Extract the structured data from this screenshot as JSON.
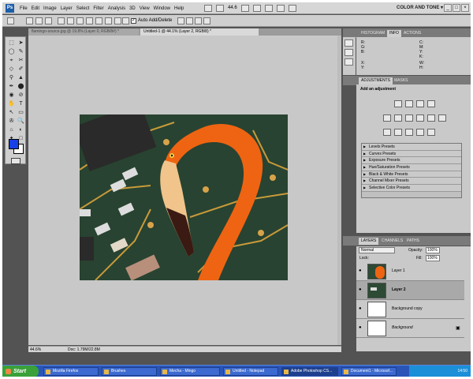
{
  "app": {
    "badge": "Ps",
    "workspace": "COLOR AND TONE ▾",
    "zoom_control": "44.6"
  },
  "menu": [
    "File",
    "Edit",
    "Image",
    "Layer",
    "Select",
    "Filter",
    "Analysis",
    "3D",
    "View",
    "Window",
    "Help"
  ],
  "window_controls": [
    "_",
    "□",
    "×"
  ],
  "options": {
    "auto_add_label": "Auto Add/Delete",
    "auto_add_checked": "✓"
  },
  "tabs": [
    {
      "label": "flamingo-source.jpg @ 19.8% (Layer 0, RGB/8#) *"
    },
    {
      "label": "Untitled-1 @ 44.1% (Layer 2, RGB/8) *"
    }
  ],
  "tools": [
    "⬚",
    "➤",
    "◯",
    "✎",
    "⌖",
    "✂",
    "◇",
    "✐",
    "⚲",
    "▲",
    "✒",
    "⬤",
    "◉",
    "⊘",
    "✋",
    "T",
    "↖",
    "▭",
    "✇",
    "🔍",
    "⌂",
    "◐",
    "✦",
    "□"
  ],
  "status": {
    "zoom": "44.6%",
    "doc": "Doc: 1.79M/22.8M"
  },
  "panel_tabs": {
    "top": [
      "HISTOGRAM",
      "INFO",
      "ACTIONS"
    ],
    "adjust": [
      "ADJUSTMENTS",
      "MASKS"
    ],
    "layers": [
      "LAYERS",
      "CHANNELS",
      "PATHS"
    ]
  },
  "info": {
    "r": "R:",
    "g": "G:",
    "b": "B:",
    "c": "C:",
    "m": "M:",
    "y": "Y:",
    "k": "K:",
    "x": "X:",
    "yy": "Y:",
    "w": "W:",
    "h": "H:"
  },
  "adjustments": {
    "title": "Add an adjustment",
    "presets": [
      "Levels Presets",
      "Curves Presets",
      "Exposure Presets",
      "Hue/Saturation Presets",
      "Black & White Presets",
      "Channel Mixer Presets",
      "Selective Color Presets"
    ]
  },
  "layers": {
    "blend": "Normal",
    "opacity_label": "Opacity:",
    "opacity": "100%",
    "lock_label": "Lock:",
    "fill_label": "Fill:",
    "fill": "100%",
    "items": [
      {
        "name": "Layer 1"
      },
      {
        "name": "Layer 2"
      },
      {
        "name": "Background copy"
      },
      {
        "name": "Background"
      }
    ]
  },
  "taskbar": {
    "start": "Start",
    "items": [
      "Mozilla Firefox",
      "Brushes",
      "Mecha - Mingo",
      "Untitled - Notepad",
      "Adobe Photoshop CS...",
      "Document1 - Microsof..."
    ],
    "clock": "14:50"
  }
}
